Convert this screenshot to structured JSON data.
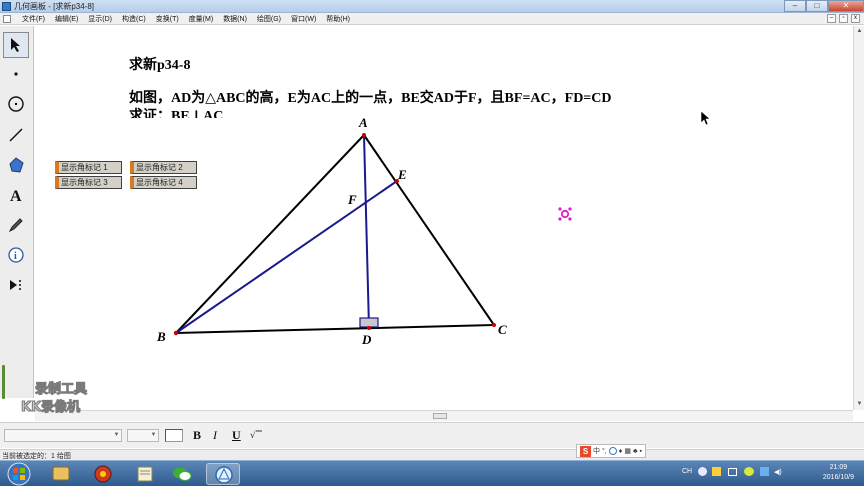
{
  "window": {
    "title": "几何画板 - [求新p34-8]"
  },
  "menubar": {
    "items": [
      "文件(F)",
      "编辑(E)",
      "显示(D)",
      "构造(C)",
      "变换(T)",
      "度量(M)",
      "数据(N)",
      "绘图(G)",
      "窗口(W)",
      "帮助(H)"
    ]
  },
  "toolbox": {
    "tools": [
      "arrow-select-tool",
      "point-tool",
      "compass-tool",
      "straightedge-tool",
      "polygon-tool",
      "text-tool",
      "marker-tool",
      "information-tool",
      "custom-tool"
    ]
  },
  "canvas": {
    "heading": "求新p34-8",
    "problem": "如图，AD为△ABC的高，E为AC上的一点，BE交AD于F，且BF=AC，FD=CD",
    "prove": "求证：BE⊥AC",
    "action_buttons": [
      "显示角标记 1",
      "显示角标记 2",
      "显示角标记 3",
      "显示角标记 4"
    ],
    "point_labels": {
      "A": "A",
      "B": "B",
      "C": "C",
      "D": "D",
      "E": "E",
      "F": "F"
    },
    "watermark": {
      "line1": "录制工具",
      "line2": "KK录像机"
    }
  },
  "textbar": {
    "bold": "B",
    "italic": "I",
    "underline": "U"
  },
  "statusbar": {
    "text": "当前被选定的：1 给图"
  },
  "ime": {
    "lang": "中"
  },
  "taskbar": {
    "time": "21:09",
    "date": "2016/10/9"
  },
  "colors": {
    "construction": "#1a1a8c",
    "points": "#cc0000",
    "triangle": "#000000",
    "button_accent": "#d97a20",
    "magenta_icon": "#e020c0"
  }
}
